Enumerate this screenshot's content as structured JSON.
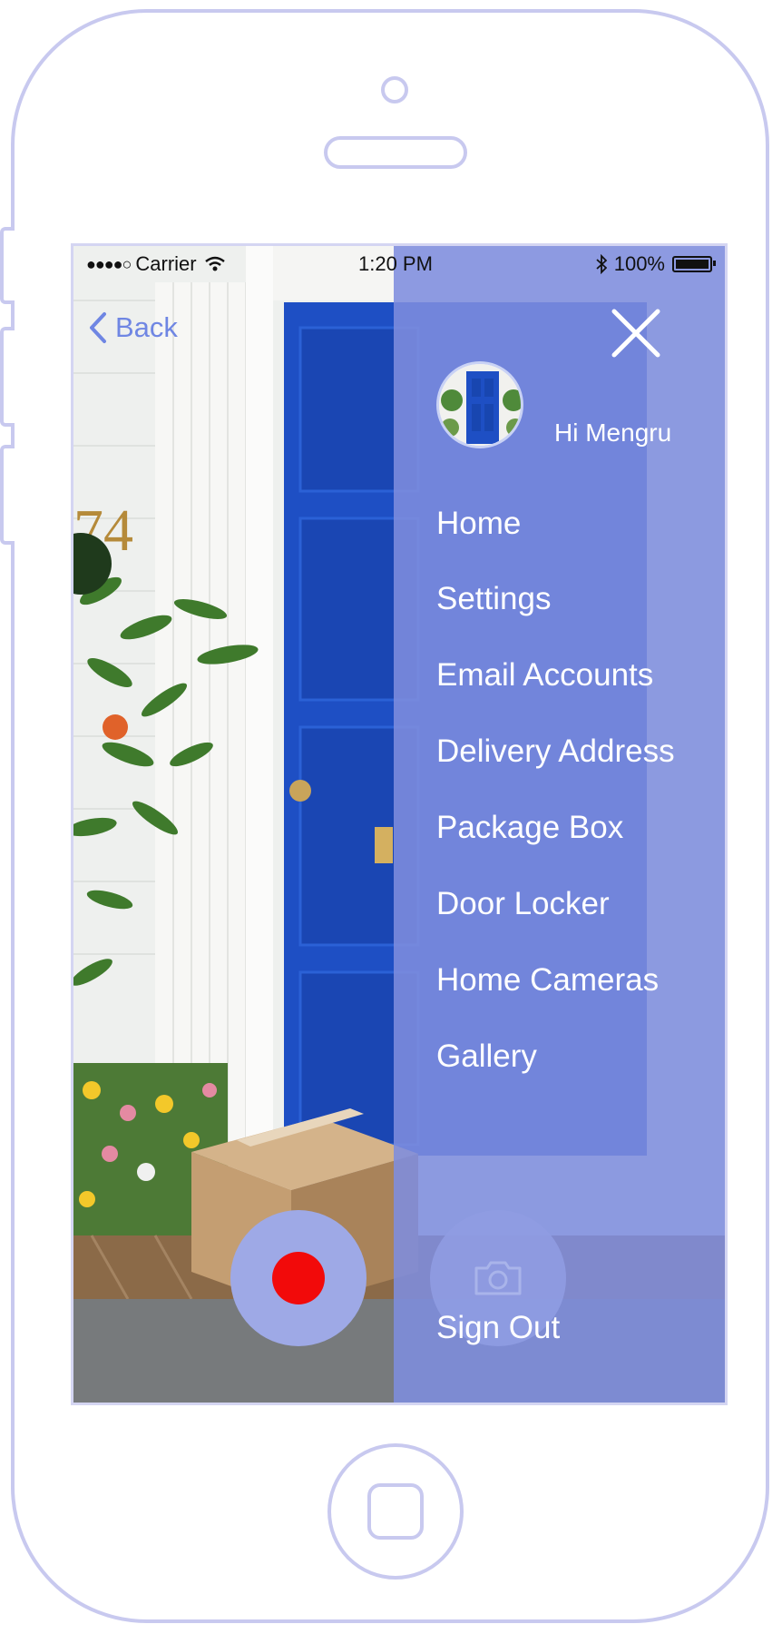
{
  "status_bar": {
    "signal": "●●●●○",
    "carrier": "Carrier",
    "time": "1:20 PM",
    "battery": "100%"
  },
  "nav": {
    "back_label": "Back"
  },
  "scene": {
    "house_number": "74"
  },
  "menu": {
    "greeting": "Hi Mengru",
    "items": [
      {
        "label": "Home"
      },
      {
        "label": "Settings"
      },
      {
        "label": "Email Accounts"
      },
      {
        "label": "Delivery Address"
      },
      {
        "label": "Package Box"
      },
      {
        "label": "Door Locker"
      },
      {
        "label": "Home Cameras"
      },
      {
        "label": "Gallery"
      }
    ],
    "sign_out": "Sign Out"
  },
  "colors": {
    "menu_overlay": "#7e8dde",
    "accent_blue": "#6f86e3",
    "record_red": "#f20a0a",
    "door_blue": "#1e4fc4",
    "frame_outline": "#c8c9ef"
  },
  "icons": [
    "wifi-icon",
    "bluetooth-icon",
    "battery-icon",
    "back-chevron-icon",
    "close-icon",
    "record-icon",
    "camera-icon"
  ]
}
